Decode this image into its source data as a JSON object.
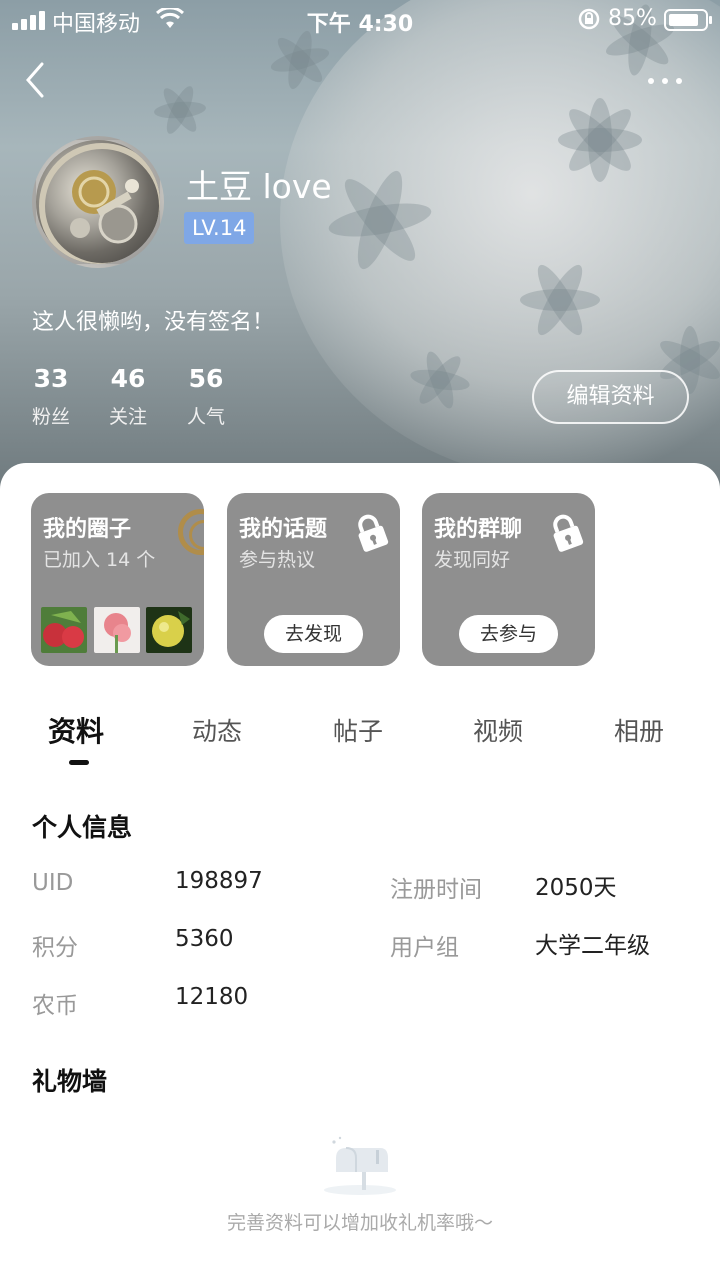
{
  "status_bar": {
    "carrier": "中国移动",
    "time": "下午 4:30",
    "battery_percent": "85%",
    "battery_level": 0.85
  },
  "profile": {
    "username": "土豆 love",
    "level": "LV.14",
    "signature": "这人很懒哟，没有签名！",
    "edit_button": "编辑资料",
    "stats": [
      {
        "value": "33",
        "label": "粉丝"
      },
      {
        "value": "46",
        "label": "关注"
      },
      {
        "value": "56",
        "label": "人气"
      }
    ]
  },
  "cards": [
    {
      "title": "我的圈子",
      "subtitle": "已加入 14 个"
    },
    {
      "title": "我的话题",
      "subtitle": "参与热议",
      "button": "去发现"
    },
    {
      "title": "我的群聊",
      "subtitle": "发现同好",
      "button": "去参与"
    }
  ],
  "tabs": [
    "资料",
    "动态",
    "帖子",
    "视频",
    "相册"
  ],
  "active_tab": "资料",
  "personal_info": {
    "title": "个人信息",
    "uid": {
      "label": "UID",
      "value": "198897"
    },
    "register_time": {
      "label": "注册时间",
      "value": "2050天"
    },
    "points": {
      "label": "积分",
      "value": "5360"
    },
    "user_group": {
      "label": "用户组",
      "value": "大学二年级"
    },
    "coins": {
      "label": "农币",
      "value": "12180"
    }
  },
  "gift_wall": {
    "title": "礼物墙",
    "empty_text": "完善资料可以增加收礼机率哦～"
  },
  "colors": {
    "level_badge": "#7fa7e6",
    "card_bg": "#8f8f8f",
    "hero_top": "#8c9ea6",
    "hero_bottom": "#6f7a7e"
  }
}
